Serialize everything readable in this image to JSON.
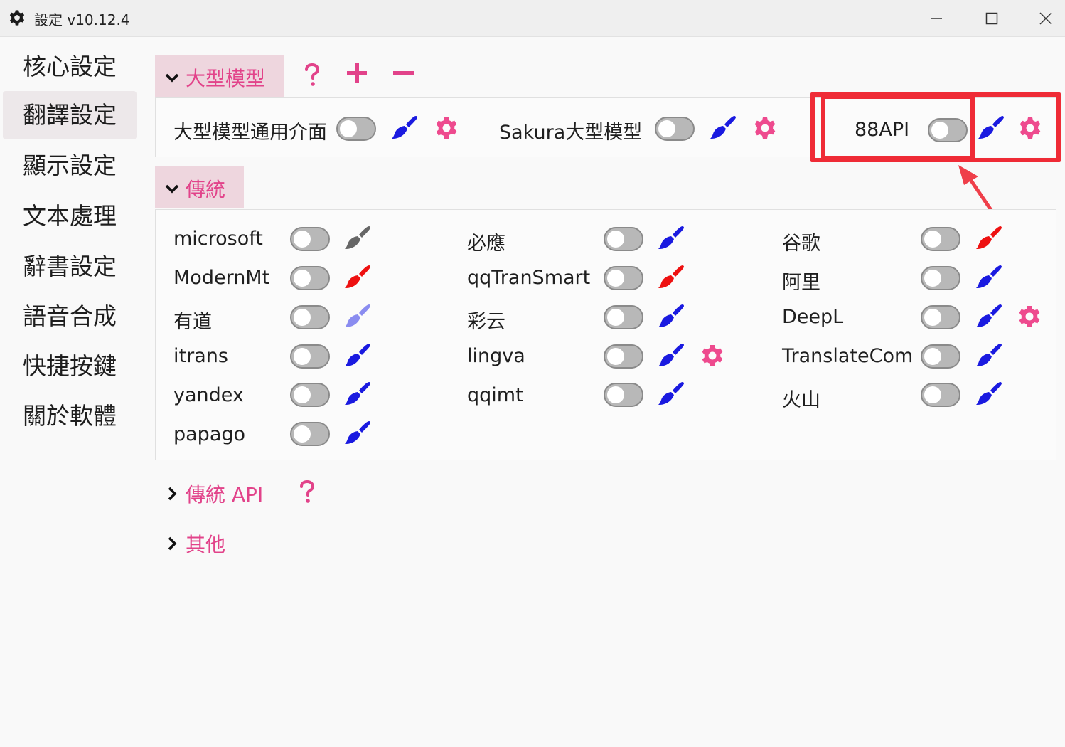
{
  "window": {
    "title": "設定 v10.12.4"
  },
  "sidebar": {
    "items": [
      {
        "label": "核心設定"
      },
      {
        "label": "翻譯設定"
      },
      {
        "label": "顯示設定"
      },
      {
        "label": "文本處理"
      },
      {
        "label": "辭書設定"
      },
      {
        "label": "語音合成"
      },
      {
        "label": "快捷按鍵"
      },
      {
        "label": "關於軟體"
      }
    ],
    "active_index": 1
  },
  "llm_section": {
    "title": "大型模型",
    "expanded": true,
    "help_icon": "question-icon",
    "add_icon": "plus-icon",
    "remove_icon": "minus-icon",
    "items": [
      {
        "label": "大型模型通用介面",
        "enabled": false,
        "brush_color": "#1a1ae0",
        "has_settings": true
      },
      {
        "label": "Sakura大型模型",
        "enabled": false,
        "brush_color": "#1a1ae0",
        "has_settings": true
      },
      {
        "label": "88API",
        "enabled": false,
        "brush_color": "#1a1ae0",
        "has_settings": true,
        "highlighted": true
      }
    ]
  },
  "traditional_section": {
    "title": "傳統",
    "expanded": true,
    "items": [
      {
        "label": "microsoft",
        "enabled": false,
        "brush_color": "#666666",
        "has_settings": false
      },
      {
        "label": "必應",
        "enabled": false,
        "brush_color": "#1a1ae0",
        "has_settings": false
      },
      {
        "label": "谷歌",
        "enabled": false,
        "brush_color": "#ee1111",
        "has_settings": false
      },
      {
        "label": "ModernMt",
        "enabled": false,
        "brush_color": "#ee1111",
        "has_settings": false
      },
      {
        "label": "qqTranSmart",
        "enabled": false,
        "brush_color": "#ee1111",
        "has_settings": false
      },
      {
        "label": "阿里",
        "enabled": false,
        "brush_color": "#1a1ae0",
        "has_settings": false
      },
      {
        "label": "有道",
        "enabled": false,
        "brush_color": "#8a8cf0",
        "has_settings": false
      },
      {
        "label": "彩云",
        "enabled": false,
        "brush_color": "#1a1ae0",
        "has_settings": false
      },
      {
        "label": "DeepL",
        "enabled": false,
        "brush_color": "#1a1ae0",
        "has_settings": true
      },
      {
        "label": "itrans",
        "enabled": false,
        "brush_color": "#1a1ae0",
        "has_settings": false
      },
      {
        "label": "lingva",
        "enabled": false,
        "brush_color": "#1a1ae0",
        "has_settings": true
      },
      {
        "label": "TranslateCom",
        "enabled": false,
        "brush_color": "#1a1ae0",
        "has_settings": false
      },
      {
        "label": "yandex",
        "enabled": false,
        "brush_color": "#1a1ae0",
        "has_settings": false
      },
      {
        "label": "qqimt",
        "enabled": false,
        "brush_color": "#1a1ae0",
        "has_settings": false
      },
      {
        "label": "火山",
        "enabled": false,
        "brush_color": "#1a1ae0",
        "has_settings": false
      },
      {
        "label": "papago",
        "enabled": false,
        "brush_color": "#1a1ae0",
        "has_settings": false
      }
    ]
  },
  "traditional_api_section": {
    "title": "傳統 API",
    "expanded": false,
    "help_icon": "question-icon"
  },
  "other_section": {
    "title": "其他",
    "expanded": false
  },
  "colors": {
    "accent": "#e2438a",
    "section_header_bg": "#eed6de",
    "highlight_red": "#ef2b36",
    "brush_blue": "#1a1ae0",
    "brush_red": "#ee1111",
    "brush_gray": "#666666",
    "brush_light_blue": "#8a8cf0",
    "gear_pink": "#ee4a8e"
  }
}
